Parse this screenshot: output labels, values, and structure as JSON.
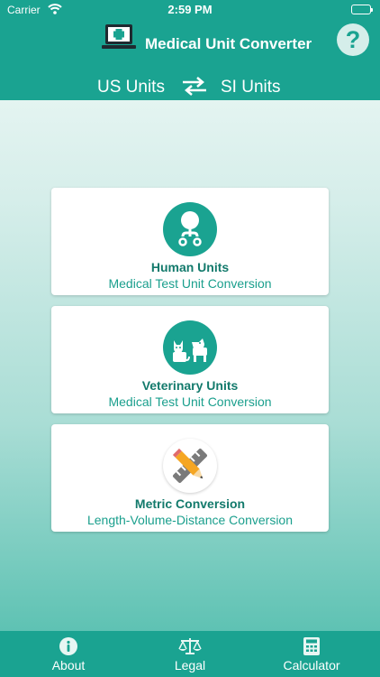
{
  "status_bar": {
    "carrier": "Carrier",
    "time": "2:59 PM"
  },
  "header": {
    "title": "Medical Unit Converter",
    "help_label": "?",
    "from_units": "US Units",
    "to_units": "SI Units"
  },
  "cards": [
    {
      "title": "Human Units",
      "subtitle": "Medical Test Unit Conversion",
      "icon": "stethoscope-icon"
    },
    {
      "title": "Veterinary Units",
      "subtitle": "Medical Test Unit Conversion",
      "icon": "cat-dog-icon"
    },
    {
      "title": "Metric Conversion",
      "subtitle": "Length-Volume-Distance Conversion",
      "icon": "ruler-pencil-icon"
    }
  ],
  "tabs": [
    {
      "label": "About",
      "icon": "info-icon"
    },
    {
      "label": "Legal",
      "icon": "scales-icon"
    },
    {
      "label": "Calculator",
      "icon": "calculator-icon"
    }
  ],
  "colors": {
    "primary": "#1aa391",
    "title_text": "#137a6c",
    "accent_orange": "#f5a623"
  }
}
